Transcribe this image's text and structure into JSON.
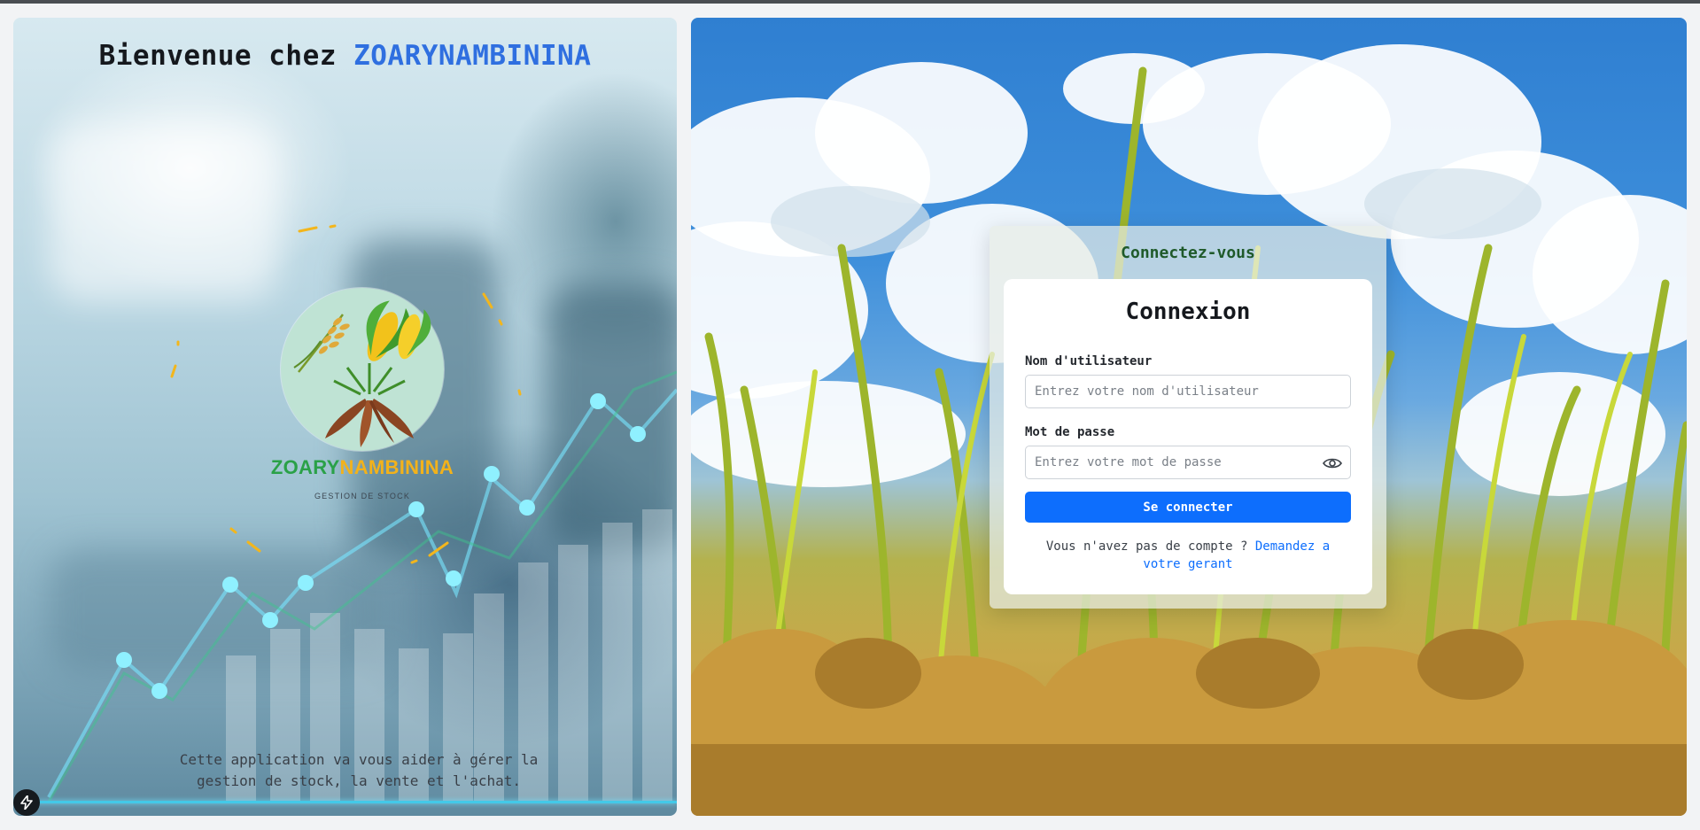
{
  "left": {
    "welcome_prefix": "Bienvenue chez ",
    "welcome_brand": "ZOARYNAMBININA",
    "logo_name_part1": "ZOARY",
    "logo_name_part2": "NAMBININA",
    "logo_subtitle": "GESTION DE STOCK",
    "description": "Cette application va vous aider à gérer la gestion de stock, la vente et l'achat.",
    "bolt_icon": "lightning-icon"
  },
  "login": {
    "card_title": "Connectez-vous",
    "form_title": "Connexion",
    "username_label": "Nom d'utilisateur",
    "username_placeholder": "Entrez votre nom d'utilisateur",
    "username_value": "",
    "password_label": "Mot de passe",
    "password_placeholder": "Entrez votre mot de passe",
    "password_value": "",
    "password_toggle_icon": "eye-icon",
    "submit_label": "Se connecter",
    "no_account_text": "Vous n'avez pas de compte ? ",
    "request_link": "Demandez a votre gerant"
  },
  "colors": {
    "brand_blue": "#2f6fe0",
    "logo_green": "#2aa148",
    "logo_yellow": "#f2b21b",
    "primary_button": "#0d6efd",
    "card_title_green": "#1f5a2a"
  }
}
